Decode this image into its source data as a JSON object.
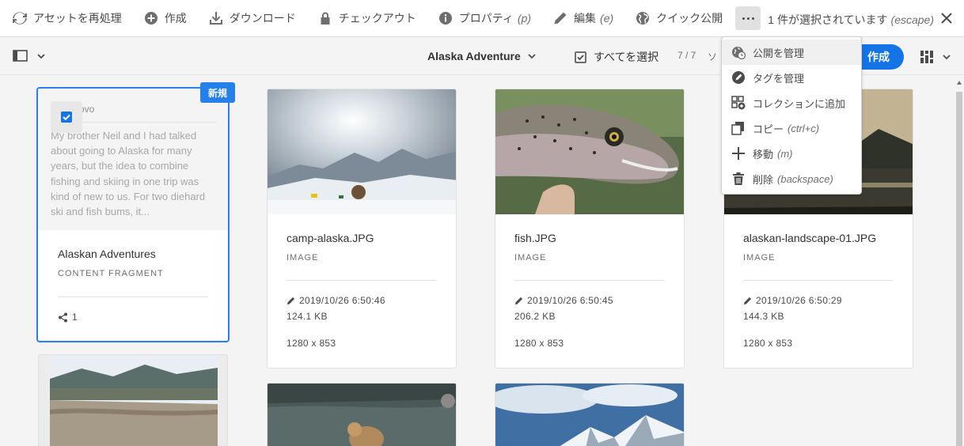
{
  "actionbar": {
    "actions": [
      {
        "label": "アセットを再処理",
        "icon": "refresh-icon"
      },
      {
        "label": "作成",
        "icon": "add-circle-icon"
      },
      {
        "label": "ダウンロード",
        "icon": "download-icon"
      },
      {
        "label": "チェックアウト",
        "icon": "lock-icon"
      },
      {
        "label": "プロパティ",
        "shortcut": "(p)",
        "icon": "info-icon"
      },
      {
        "label": "編集",
        "shortcut": "(e)",
        "icon": "pencil-icon"
      },
      {
        "label": "クイック公開",
        "icon": "globe-icon"
      }
    ],
    "more_icon": "more-icon",
    "selection_text": "1 件が選択されています",
    "selection_shortcut": "(escape)"
  },
  "toolbar": {
    "breadcrumb": "Alaska Adventure",
    "select_all": "すべてを選択",
    "count": "7 / 7",
    "sort_label": "ソ",
    "create": "作成"
  },
  "menu": {
    "items": [
      {
        "label": "公開を管理",
        "icon": "manage-publication-icon"
      },
      {
        "label": "タグを管理",
        "icon": "tag-icon"
      },
      {
        "label": "コレクションに追加",
        "icon": "add-to-collection-icon"
      },
      {
        "label": "コピー",
        "shortcut": "(ctrl+c)",
        "icon": "copy-icon"
      },
      {
        "label": "移動",
        "shortcut": "(m)",
        "icon": "move-icon"
      },
      {
        "label": "削除",
        "shortcut": "(backspace)",
        "icon": "delete-icon"
      }
    ]
  },
  "fragment": {
    "badge": "新規",
    "preview_heading": "Provo",
    "preview_text": "My brother Neil and I had talked about going to Alaska for many years, but the idea to combine fishing and skiing in one trip was kind of new to us. For two diehard ski and fish bums, it...",
    "title": "Alaskan Adventures",
    "type": "CONTENT FRAGMENT",
    "refs": "1"
  },
  "assets": [
    {
      "name": "camp-alaska.JPG",
      "type": "IMAGE",
      "modified": "2019/10/26 6:50:46",
      "size": "124.1 KB",
      "dims": "1280 x 853"
    },
    {
      "name": "fish.JPG",
      "type": "IMAGE",
      "modified": "2019/10/26 6:50:45",
      "size": "206.2 KB",
      "dims": "1280 x 853"
    },
    {
      "name": "alaskan-landscape-01.JPG",
      "type": "IMAGE",
      "modified": "2019/10/26 6:50:29",
      "size": "144.3 KB",
      "dims": "1280 x 853"
    }
  ],
  "colors": {
    "accent": "#1473e6",
    "selection": "#2680eb"
  }
}
